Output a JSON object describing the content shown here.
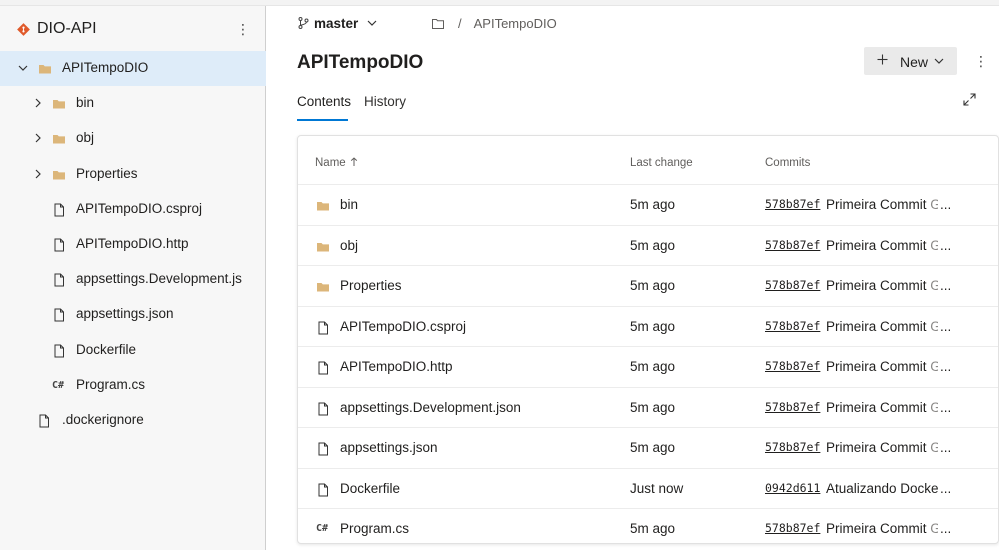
{
  "repo": {
    "name": "DIO-API",
    "accent": "#e05a2b"
  },
  "tree": [
    {
      "label": "APITempoDIO",
      "type": "folder",
      "expanded": true,
      "selected": true,
      "level": 0,
      "icon": "folder-icon"
    },
    {
      "label": "bin",
      "type": "folder",
      "expanded": false,
      "level": 1,
      "icon": "folder-icon"
    },
    {
      "label": "obj",
      "type": "folder",
      "expanded": false,
      "level": 1,
      "icon": "folder-icon"
    },
    {
      "label": "Properties",
      "type": "folder",
      "expanded": false,
      "level": 1,
      "icon": "folder-icon"
    },
    {
      "label": "APITempoDIO.csproj",
      "type": "file",
      "level": 1,
      "icon": "file-icon"
    },
    {
      "label": "APITempoDIO.http",
      "type": "file",
      "level": 1,
      "icon": "file-icon"
    },
    {
      "label": "appsettings.Development.js",
      "type": "file",
      "level": 1,
      "icon": "file-icon"
    },
    {
      "label": "appsettings.json",
      "type": "file",
      "level": 1,
      "icon": "file-icon"
    },
    {
      "label": "Dockerfile",
      "type": "file",
      "level": 1,
      "icon": "file-icon"
    },
    {
      "label": "Program.cs",
      "type": "csharp",
      "level": 1,
      "icon": "csharp-icon"
    },
    {
      "label": ".dockerignore",
      "type": "file",
      "level": 0,
      "icon": "file-icon"
    }
  ],
  "branch": {
    "name": "master"
  },
  "breadcrumb": {
    "separator": "/",
    "path": "APITempoDIO"
  },
  "page": {
    "title": "APITempoDIO"
  },
  "toolbar": {
    "new_label": "New"
  },
  "tabs": {
    "contents": "Contents",
    "history": "History"
  },
  "table": {
    "headers": {
      "name": "Name",
      "last_change": "Last change",
      "commits": "Commits"
    },
    "rows": [
      {
        "name": "bin",
        "type": "folder",
        "last_change": "5m ago",
        "commit": "578b87ef",
        "message": "Primeira Commit",
        "author": "Gu"
      },
      {
        "name": "obj",
        "type": "folder",
        "last_change": "5m ago",
        "commit": "578b87ef",
        "message": "Primeira Commit",
        "author": "Gu"
      },
      {
        "name": "Properties",
        "type": "folder",
        "last_change": "5m ago",
        "commit": "578b87ef",
        "message": "Primeira Commit",
        "author": "Gu"
      },
      {
        "name": "APITempoDIO.csproj",
        "type": "file",
        "last_change": "5m ago",
        "commit": "578b87ef",
        "message": "Primeira Commit",
        "author": "Gu"
      },
      {
        "name": "APITempoDIO.http",
        "type": "file",
        "last_change": "5m ago",
        "commit": "578b87ef",
        "message": "Primeira Commit",
        "author": "Gu"
      },
      {
        "name": "appsettings.Development.json",
        "type": "file",
        "last_change": "5m ago",
        "commit": "578b87ef",
        "message": "Primeira Commit",
        "author": "Gu"
      },
      {
        "name": "appsettings.json",
        "type": "file",
        "last_change": "5m ago",
        "commit": "578b87ef",
        "message": "Primeira Commit",
        "author": "Gu"
      },
      {
        "name": "Dockerfile",
        "type": "file",
        "last_change": "Just now",
        "commit": "0942d611",
        "message": "Atualizando Docker",
        "author": ""
      },
      {
        "name": "Program.cs",
        "type": "csharp",
        "last_change": "5m ago",
        "commit": "578b87ef",
        "message": "Primeira Commit",
        "author": "Gu"
      }
    ]
  },
  "colors": {
    "folder": "#dcb67a",
    "selected_bg": "#deecf9",
    "tab_underline": "#0078d4"
  }
}
